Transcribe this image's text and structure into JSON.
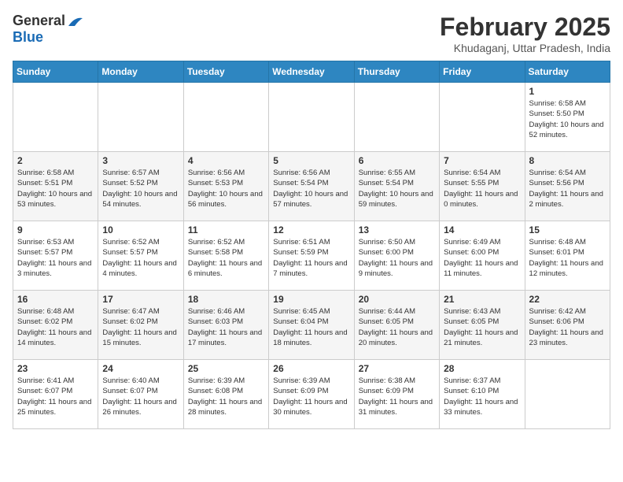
{
  "logo": {
    "general": "General",
    "blue": "Blue"
  },
  "title": "February 2025",
  "location": "Khudaganj, Uttar Pradesh, India",
  "days_of_week": [
    "Sunday",
    "Monday",
    "Tuesday",
    "Wednesday",
    "Thursday",
    "Friday",
    "Saturday"
  ],
  "weeks": [
    [
      {
        "day": "",
        "info": ""
      },
      {
        "day": "",
        "info": ""
      },
      {
        "day": "",
        "info": ""
      },
      {
        "day": "",
        "info": ""
      },
      {
        "day": "",
        "info": ""
      },
      {
        "day": "",
        "info": ""
      },
      {
        "day": "1",
        "info": "Sunrise: 6:58 AM\nSunset: 5:50 PM\nDaylight: 10 hours and 52 minutes."
      }
    ],
    [
      {
        "day": "2",
        "info": "Sunrise: 6:58 AM\nSunset: 5:51 PM\nDaylight: 10 hours and 53 minutes."
      },
      {
        "day": "3",
        "info": "Sunrise: 6:57 AM\nSunset: 5:52 PM\nDaylight: 10 hours and 54 minutes."
      },
      {
        "day": "4",
        "info": "Sunrise: 6:56 AM\nSunset: 5:53 PM\nDaylight: 10 hours and 56 minutes."
      },
      {
        "day": "5",
        "info": "Sunrise: 6:56 AM\nSunset: 5:54 PM\nDaylight: 10 hours and 57 minutes."
      },
      {
        "day": "6",
        "info": "Sunrise: 6:55 AM\nSunset: 5:54 PM\nDaylight: 10 hours and 59 minutes."
      },
      {
        "day": "7",
        "info": "Sunrise: 6:54 AM\nSunset: 5:55 PM\nDaylight: 11 hours and 0 minutes."
      },
      {
        "day": "8",
        "info": "Sunrise: 6:54 AM\nSunset: 5:56 PM\nDaylight: 11 hours and 2 minutes."
      }
    ],
    [
      {
        "day": "9",
        "info": "Sunrise: 6:53 AM\nSunset: 5:57 PM\nDaylight: 11 hours and 3 minutes."
      },
      {
        "day": "10",
        "info": "Sunrise: 6:52 AM\nSunset: 5:57 PM\nDaylight: 11 hours and 4 minutes."
      },
      {
        "day": "11",
        "info": "Sunrise: 6:52 AM\nSunset: 5:58 PM\nDaylight: 11 hours and 6 minutes."
      },
      {
        "day": "12",
        "info": "Sunrise: 6:51 AM\nSunset: 5:59 PM\nDaylight: 11 hours and 7 minutes."
      },
      {
        "day": "13",
        "info": "Sunrise: 6:50 AM\nSunset: 6:00 PM\nDaylight: 11 hours and 9 minutes."
      },
      {
        "day": "14",
        "info": "Sunrise: 6:49 AM\nSunset: 6:00 PM\nDaylight: 11 hours and 11 minutes."
      },
      {
        "day": "15",
        "info": "Sunrise: 6:48 AM\nSunset: 6:01 PM\nDaylight: 11 hours and 12 minutes."
      }
    ],
    [
      {
        "day": "16",
        "info": "Sunrise: 6:48 AM\nSunset: 6:02 PM\nDaylight: 11 hours and 14 minutes."
      },
      {
        "day": "17",
        "info": "Sunrise: 6:47 AM\nSunset: 6:02 PM\nDaylight: 11 hours and 15 minutes."
      },
      {
        "day": "18",
        "info": "Sunrise: 6:46 AM\nSunset: 6:03 PM\nDaylight: 11 hours and 17 minutes."
      },
      {
        "day": "19",
        "info": "Sunrise: 6:45 AM\nSunset: 6:04 PM\nDaylight: 11 hours and 18 minutes."
      },
      {
        "day": "20",
        "info": "Sunrise: 6:44 AM\nSunset: 6:05 PM\nDaylight: 11 hours and 20 minutes."
      },
      {
        "day": "21",
        "info": "Sunrise: 6:43 AM\nSunset: 6:05 PM\nDaylight: 11 hours and 21 minutes."
      },
      {
        "day": "22",
        "info": "Sunrise: 6:42 AM\nSunset: 6:06 PM\nDaylight: 11 hours and 23 minutes."
      }
    ],
    [
      {
        "day": "23",
        "info": "Sunrise: 6:41 AM\nSunset: 6:07 PM\nDaylight: 11 hours and 25 minutes."
      },
      {
        "day": "24",
        "info": "Sunrise: 6:40 AM\nSunset: 6:07 PM\nDaylight: 11 hours and 26 minutes."
      },
      {
        "day": "25",
        "info": "Sunrise: 6:39 AM\nSunset: 6:08 PM\nDaylight: 11 hours and 28 minutes."
      },
      {
        "day": "26",
        "info": "Sunrise: 6:39 AM\nSunset: 6:09 PM\nDaylight: 11 hours and 30 minutes."
      },
      {
        "day": "27",
        "info": "Sunrise: 6:38 AM\nSunset: 6:09 PM\nDaylight: 11 hours and 31 minutes."
      },
      {
        "day": "28",
        "info": "Sunrise: 6:37 AM\nSunset: 6:10 PM\nDaylight: 11 hours and 33 minutes."
      },
      {
        "day": "",
        "info": ""
      }
    ]
  ]
}
